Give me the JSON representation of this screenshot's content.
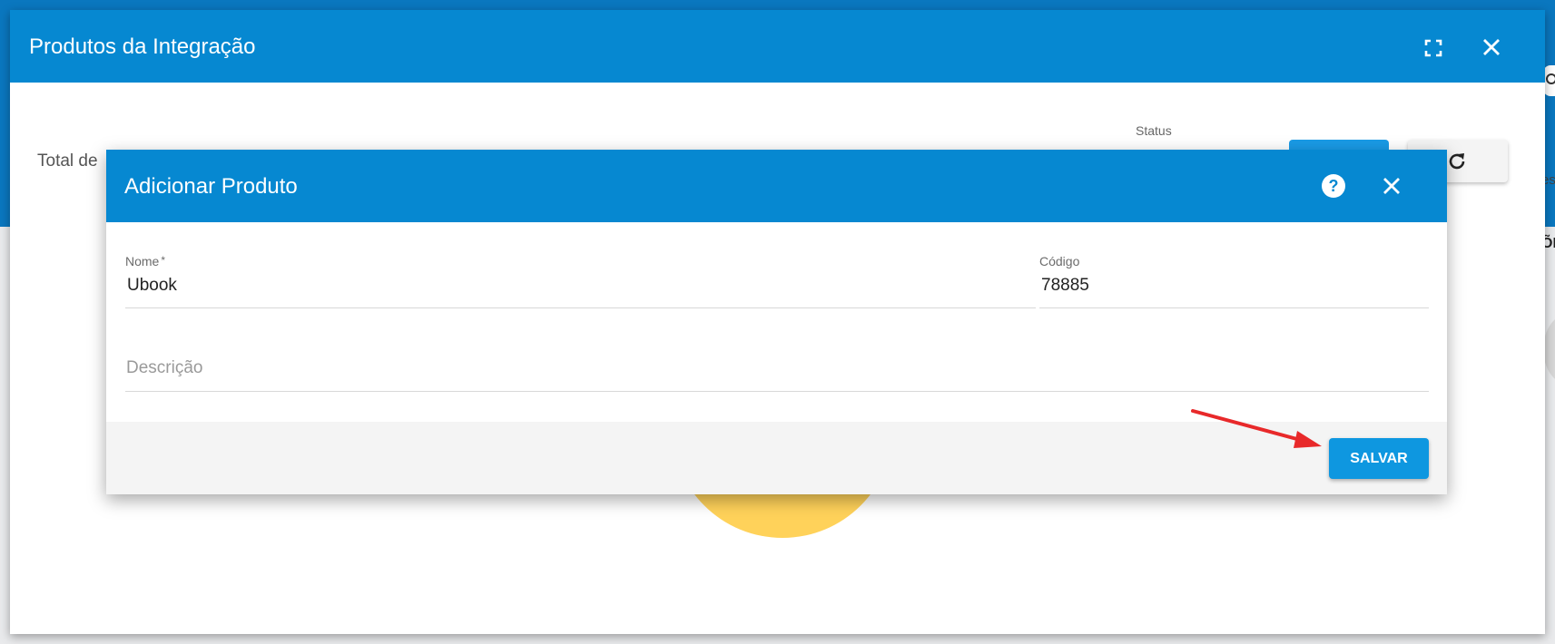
{
  "outer_modal": {
    "title": "Produtos da Integração",
    "total_label": "Total de",
    "status_label": "Status"
  },
  "dialog": {
    "title": "Adicionar Produto",
    "fields": {
      "nome": {
        "label": "Nome",
        "required_mark": "*",
        "value": "Ubook"
      },
      "codigo": {
        "label": "Código",
        "value": "78885"
      },
      "descricao": {
        "placeholder": "Descrição",
        "value": ""
      }
    },
    "save_label": "SALVAR"
  },
  "background": {
    "right_text_1": "es",
    "right_text_2": "ÕE"
  },
  "colors": {
    "header_blue": "#0688d1",
    "button_blue": "#0e97e0",
    "annotation_red": "#e8292a",
    "decor_yellow": "#ffd25a"
  },
  "icons": {
    "fullscreen": "fullscreen-icon",
    "close": "close-icon",
    "help": "help-icon",
    "refresh": "refresh-icon",
    "search": "search-icon",
    "annotation": "arrow-annotation"
  }
}
